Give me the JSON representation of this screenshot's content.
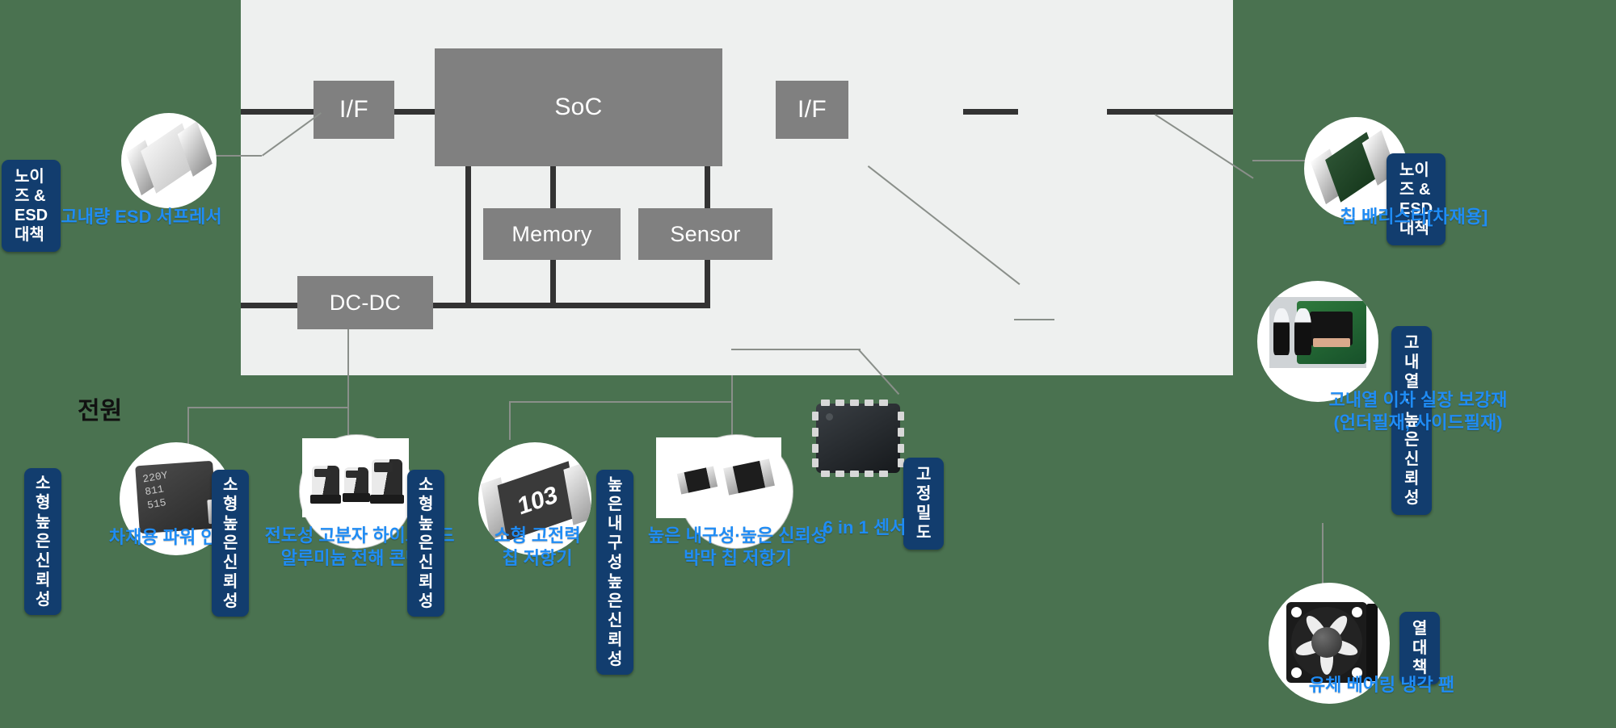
{
  "diagram": {
    "section_label": "전원",
    "blocks": [
      {
        "id": "if-left",
        "label": "I/F"
      },
      {
        "id": "soc",
        "label": "SoC"
      },
      {
        "id": "if-right",
        "label": "I/F"
      },
      {
        "id": "memory",
        "label": "Memory"
      },
      {
        "id": "sensor",
        "label": "Sensor"
      },
      {
        "id": "dcdc",
        "label": "DC-DC"
      }
    ]
  },
  "colors": {
    "background": "#4a7250",
    "panel": "#eef0ef",
    "block": "#808080",
    "badge": "#123d6e",
    "caption": "#1f8cf5",
    "wire": "#333333",
    "leader": "#8a8f8a"
  },
  "products": [
    {
      "id": "esd-suppressor",
      "badge": "노이즈 & ESD 대책",
      "caption": "고내량 ESD 서프레서",
      "icon": "chip-component-icon"
    },
    {
      "id": "chip-varistor",
      "badge": "노이즈 & ESD 대책",
      "caption": "칩 배리스터[차재용]",
      "icon": "green-chip-varistor-icon"
    },
    {
      "id": "underfill",
      "badge": "고내열·높은 신뢰성",
      "caption": "고내열 이차 실장 보강재\n(언더필재, 사이드필재)",
      "icon": "underfill-syringe-pcb-icon"
    },
    {
      "id": "cooling-fan",
      "badge": "열 대책",
      "caption": "유체 베어링 냉각 팬",
      "icon": "cooling-fan-icon"
    },
    {
      "id": "power-inductor",
      "badge": "소형\n높은 신뢰성",
      "caption": "차재용 파워 인덕터",
      "icon": "power-inductor-icon"
    },
    {
      "id": "hybrid-capacitor",
      "badge": "소형\n높은 신뢰성",
      "caption": "전도성 고분자 하이브리드\n알루미늄 전해 콘덴서",
      "icon": "electrolytic-capacitor-icon"
    },
    {
      "id": "chip-resistor",
      "badge": "소형\n높은 신뢰성",
      "caption": "소형 고전력\n칩 저항기",
      "icon": "chip-resistor-icon",
      "marking": "103"
    },
    {
      "id": "thin-film-resistor",
      "badge": "높은 내구성\n높은 신뢰성",
      "caption": "높은 내구성·높은 신뢰성\n박막 칩 저항기",
      "icon": "thin-film-resistor-icon"
    },
    {
      "id": "six-in-one-sensor",
      "badge": "고정밀도",
      "caption": "6 in 1 센서",
      "icon": "qfn-sensor-icon"
    }
  ]
}
